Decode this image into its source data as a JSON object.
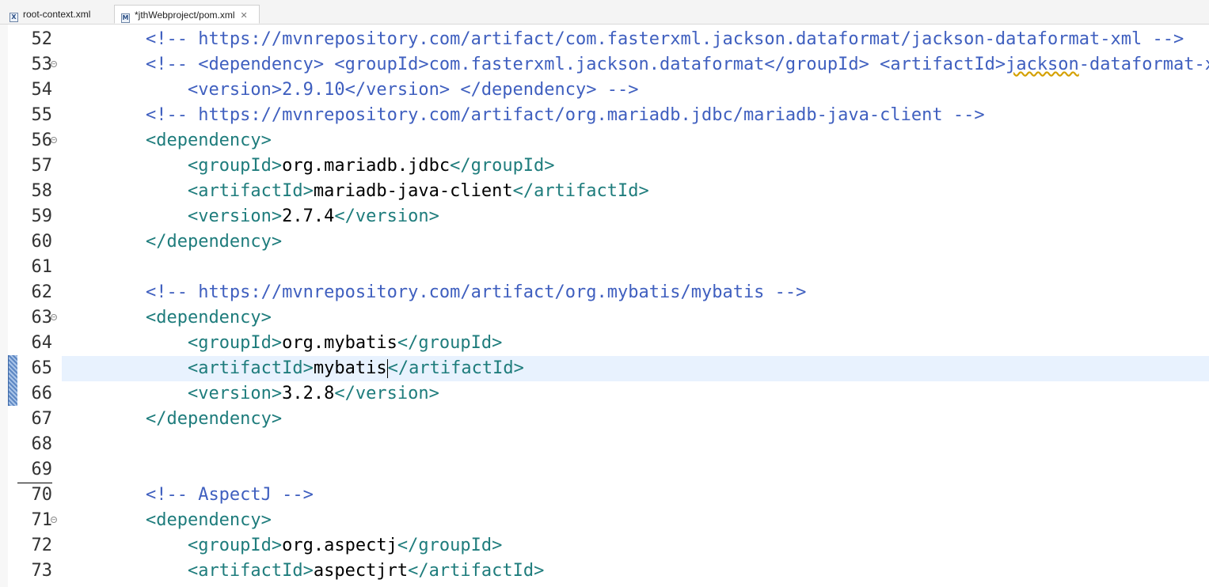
{
  "tabs": [
    {
      "label": "root-context.xml",
      "icon": "xml-file-icon",
      "active": false,
      "dirty": false
    },
    {
      "label": "*jthWebproject/pom.xml",
      "icon": "maven-pom-file-icon",
      "active": true,
      "dirty": true
    }
  ],
  "editor": {
    "current_line": "65",
    "lines": [
      {
        "n": "52",
        "fold": false,
        "indent": "        ",
        "segs": [
          [
            "cm",
            "<!-- https://mvnrepository.com/artifact/com.fasterxml.jackson.dataformat/jackson-dataformat-xml -->"
          ]
        ]
      },
      {
        "n": "53",
        "fold": true,
        "indent": "        ",
        "segs": [
          [
            "cm",
            "<!-- <dependency> <groupId>com.fasterxml.jackson.dataformat</groupId> <artifactId>"
          ],
          [
            "cm typo",
            "jackson"
          ],
          [
            "cm",
            "-dataformat-xml</artifactId>"
          ]
        ]
      },
      {
        "n": "54",
        "fold": false,
        "indent": "            ",
        "segs": [
          [
            "cm",
            "<version>2.9.10</version> </dependency> -->"
          ]
        ]
      },
      {
        "n": "55",
        "fold": false,
        "indent": "        ",
        "segs": [
          [
            "cm",
            "<!-- https://mvnrepository.com/artifact/org.mariadb.jdbc/mariadb-java-client -->"
          ]
        ]
      },
      {
        "n": "56",
        "fold": true,
        "indent": "        ",
        "segs": [
          [
            "tag",
            "<dependency>"
          ]
        ]
      },
      {
        "n": "57",
        "fold": false,
        "indent": "            ",
        "segs": [
          [
            "tag",
            "<groupId>"
          ],
          [
            "txt",
            "org.mariadb.jdbc"
          ],
          [
            "tag",
            "</groupId>"
          ]
        ]
      },
      {
        "n": "58",
        "fold": false,
        "indent": "            ",
        "segs": [
          [
            "tag",
            "<artifactId>"
          ],
          [
            "txt",
            "mariadb-java-client"
          ],
          [
            "tag",
            "</artifactId>"
          ]
        ]
      },
      {
        "n": "59",
        "fold": false,
        "indent": "            ",
        "segs": [
          [
            "tag",
            "<version>"
          ],
          [
            "txt",
            "2.7.4"
          ],
          [
            "tag",
            "</version>"
          ]
        ]
      },
      {
        "n": "60",
        "fold": false,
        "indent": "        ",
        "segs": [
          [
            "tag",
            "</dependency>"
          ]
        ]
      },
      {
        "n": "61",
        "fold": false,
        "indent": "",
        "segs": []
      },
      {
        "n": "62",
        "fold": false,
        "indent": "        ",
        "segs": [
          [
            "cm",
            "<!-- https://mvnrepository.com/artifact/org.mybatis/mybatis -->"
          ]
        ]
      },
      {
        "n": "63",
        "fold": true,
        "indent": "        ",
        "segs": [
          [
            "tag",
            "<dependency>"
          ]
        ]
      },
      {
        "n": "64",
        "fold": false,
        "indent": "            ",
        "segs": [
          [
            "tag",
            "<groupId>"
          ],
          [
            "txt",
            "org.mybatis"
          ],
          [
            "tag",
            "</groupId>"
          ]
        ]
      },
      {
        "n": "65",
        "fold": false,
        "indent": "            ",
        "segs": [
          [
            "tag",
            "<artifactId>"
          ],
          [
            "txt",
            "mybatis"
          ],
          [
            "caret",
            ""
          ],
          [
            "tag",
            "</artifactId>"
          ]
        ]
      },
      {
        "n": "66",
        "fold": false,
        "indent": "            ",
        "segs": [
          [
            "tag",
            "<version>"
          ],
          [
            "txt",
            "3.2.8"
          ],
          [
            "tag",
            "</version>"
          ]
        ]
      },
      {
        "n": "67",
        "fold": false,
        "indent": "        ",
        "segs": [
          [
            "tag",
            "</dependency>"
          ]
        ]
      },
      {
        "n": "68",
        "fold": false,
        "indent": "",
        "segs": []
      },
      {
        "n": "69",
        "fold": false,
        "indent": "",
        "segs": [],
        "underline": true
      },
      {
        "n": "70",
        "fold": false,
        "indent": "        ",
        "segs": [
          [
            "cm",
            "<!-- AspectJ -->"
          ]
        ]
      },
      {
        "n": "71",
        "fold": true,
        "indent": "        ",
        "segs": [
          [
            "tag",
            "<dependency>"
          ]
        ]
      },
      {
        "n": "72",
        "fold": false,
        "indent": "            ",
        "segs": [
          [
            "tag",
            "<groupId>"
          ],
          [
            "txt",
            "org.aspectj"
          ],
          [
            "tag",
            "</groupId>"
          ]
        ]
      },
      {
        "n": "73",
        "fold": false,
        "indent": "            ",
        "segs": [
          [
            "tag",
            "<artifactId>"
          ],
          [
            "txt",
            "aspectjrt"
          ],
          [
            "tag",
            "</artifactId>"
          ]
        ]
      }
    ]
  },
  "colors": {
    "comment": "#3f5fbf",
    "tag": "#1e7c7c",
    "text": "#000000",
    "current_line_bg": "#e8f2fe",
    "change_marker": "#5d87c3"
  }
}
